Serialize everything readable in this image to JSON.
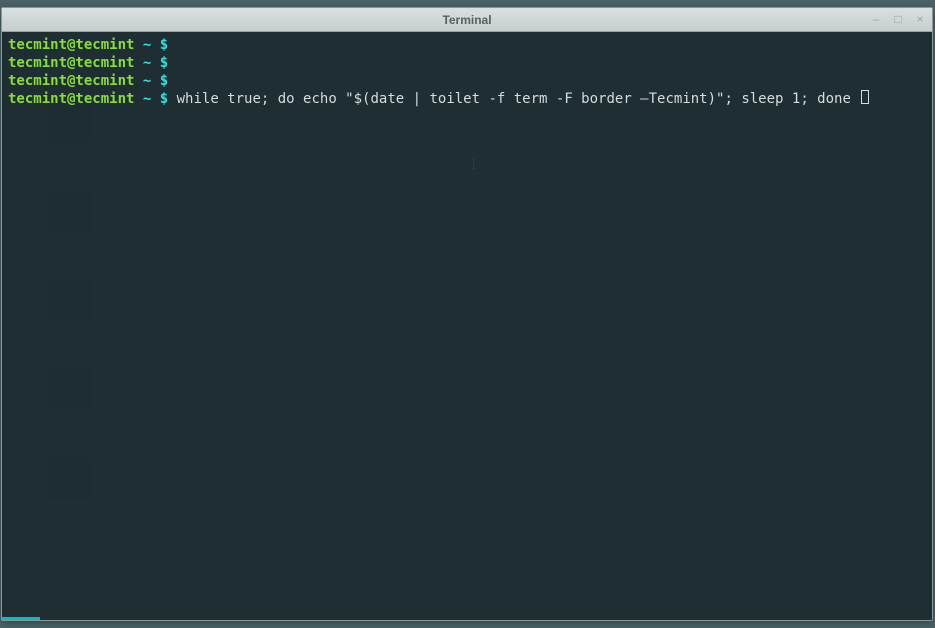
{
  "window": {
    "title": "Terminal",
    "controls": {
      "minimize": "–",
      "maximize": "□",
      "close": "×"
    }
  },
  "terminal": {
    "lines": [
      {
        "user_host": "tecmint@tecmint",
        "tilde": " ~ ",
        "dollar": "$",
        "command": ""
      },
      {
        "user_host": "tecmint@tecmint",
        "tilde": " ~ ",
        "dollar": "$",
        "command": ""
      },
      {
        "user_host": "tecmint@tecmint",
        "tilde": " ~ ",
        "dollar": "$",
        "command": ""
      },
      {
        "user_host": "tecmint@tecmint",
        "tilde": " ~ ",
        "dollar": "$",
        "command": " while true; do echo \"$(date | toilet -f term -F border –Tecmint)\"; sleep 1; done "
      }
    ]
  },
  "cursor_glyph": "I"
}
